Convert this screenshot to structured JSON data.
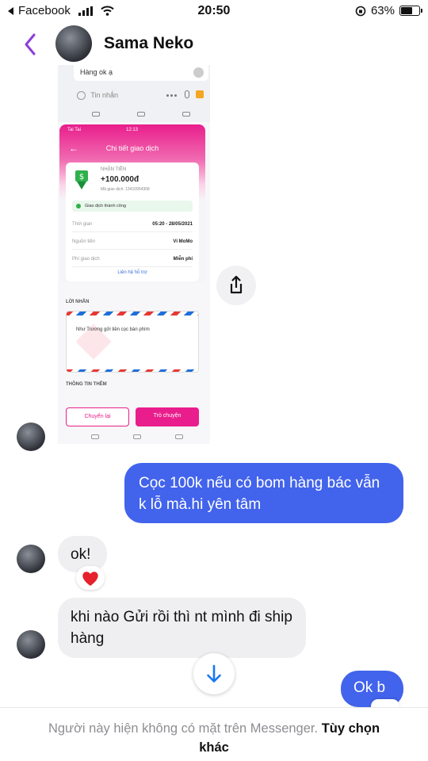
{
  "status_bar": {
    "back_app": "Facebook",
    "time": "20:50",
    "battery": "63%",
    "battery_level": 0.63
  },
  "header": {
    "contact_name": "Sama Neko",
    "back_icon": "chevron-left-icon"
  },
  "shared_photo": {
    "prev_message": "Hàng ok ạ",
    "input_placeholder": "Tin nhắn",
    "card": {
      "title": "Chi tiết giao dịch",
      "carrier": "Tai Tai",
      "time": "12:13",
      "label_receive": "NHẬN TIỀN",
      "amount": "+100.000đ",
      "txn_code_label": "Mã giao dịch: 13410954368",
      "status": "Giao dịch thành công",
      "rows": [
        {
          "label": "Thời gian",
          "value": "05:20 - 28/05/2021"
        },
        {
          "label": "Nguồn tiền",
          "value": "Ví MoMo"
        },
        {
          "label": "Phí giao dịch",
          "value": "Miễn phí"
        }
      ],
      "link": "Liên hệ hỗ trợ"
    },
    "section_message": "LỜI NHẮN",
    "note_text": "Như Trương gửi tiền cọc bàn phím",
    "section_more": "THÔNG TIN THÊM",
    "button_resend": "Chuyển lại",
    "button_chat": "Trò chuyện"
  },
  "messages": {
    "outgoing_1": "Cọc 100k nếu có bom hàng bác vẫn k lỗ mà.hi yên tâm",
    "incoming_1": "ok!",
    "reaction": "❤️",
    "incoming_2": "khi nào Gửi rồi thì nt mình đi ship hàng",
    "outgoing_2": "Ok b"
  },
  "footer": {
    "notice": "Người này hiện không có mặt trên Messenger.",
    "options": "Tùy chọn khác"
  },
  "colors": {
    "accent": "#4263eb",
    "back_chevron": "#8b3fd9",
    "momo_pink": "#e91e8c"
  }
}
